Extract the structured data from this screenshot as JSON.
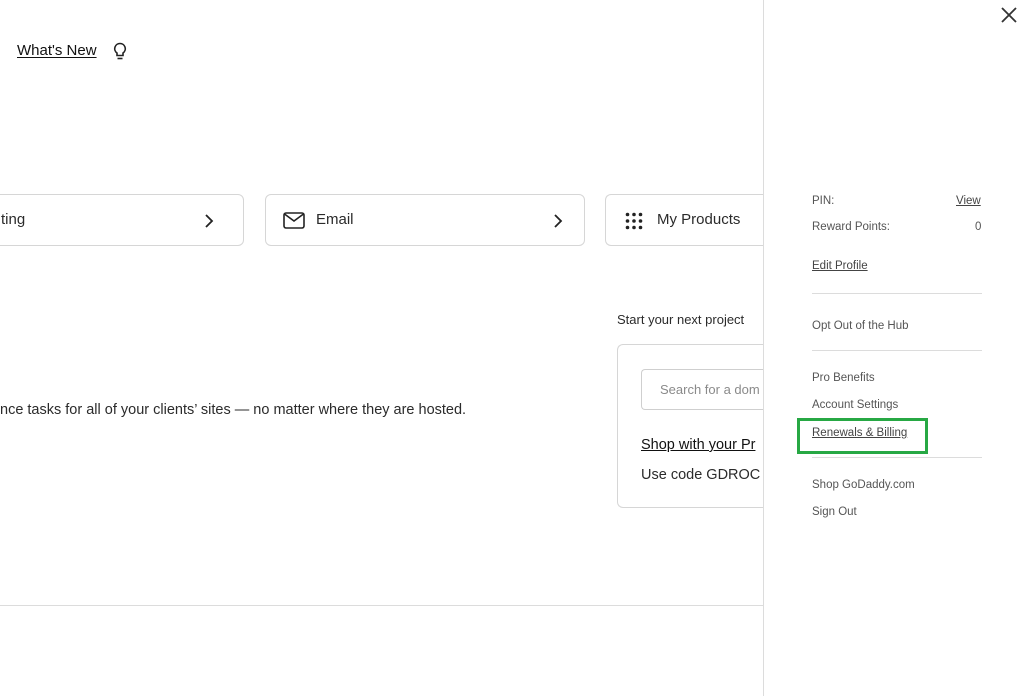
{
  "header": {
    "whats_new": "What's New"
  },
  "nav_cards": [
    {
      "label": "ting"
    },
    {
      "label": "Email"
    },
    {
      "label": "My Products"
    }
  ],
  "main": {
    "description": "nce tasks for all of your clients’ sites — no matter where they are hosted."
  },
  "project": {
    "title": "Start your next project",
    "search_placeholder": "Search for a dom",
    "shop_link": "Shop with your Pr",
    "promo": "Use code GDROC"
  },
  "drawer": {
    "pin_label": "PIN:",
    "pin_view": "View",
    "reward_label": "Reward Points:",
    "reward_value": "0",
    "edit_profile": "Edit Profile",
    "opt_out": "Opt Out of the Hub",
    "pro_benefits": "Pro Benefits",
    "account_settings": "Account Settings",
    "renewals_billing": "Renewals & Billing",
    "shop_godaddy": "Shop GoDaddy.com",
    "sign_out": "Sign Out"
  },
  "colors": {
    "highlight": "#27a844",
    "border": "#d6d6d6",
    "text": "#2b2b2b"
  },
  "icons": [
    "lightbulb-icon",
    "chevron-right-icon",
    "envelope-icon",
    "grid-icon",
    "close-icon"
  ]
}
